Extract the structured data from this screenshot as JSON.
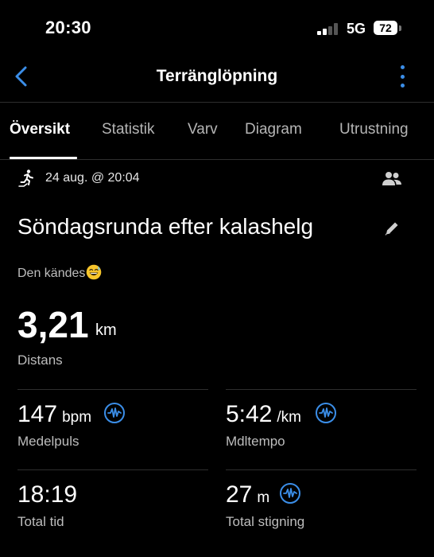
{
  "status_bar": {
    "time": "20:30",
    "network": "5G",
    "battery": "72"
  },
  "header": {
    "title": "Terränglöpning"
  },
  "tabs": [
    {
      "label": "Översikt",
      "active": true
    },
    {
      "label": "Statistik"
    },
    {
      "label": "Varv"
    },
    {
      "label": "Diagram"
    },
    {
      "label": "Utrustning"
    }
  ],
  "activity": {
    "date": "24 aug. @ 20:04",
    "name": "Söndagsrunda efter kalashelg",
    "description": "Den kändes"
  },
  "metrics": {
    "distance": {
      "value": "3,21",
      "unit": "km",
      "label": "Distans"
    },
    "avg_hr": {
      "value": "147",
      "unit": "bpm",
      "label": "Medelpuls"
    },
    "avg_pace": {
      "value": "5:42",
      "unit": "/km",
      "label": "Mdltempo"
    },
    "total_time": {
      "value": "18:19",
      "label": "Total tid"
    },
    "total_ascent": {
      "value": "27",
      "unit": "m",
      "label": "Total stigning"
    }
  },
  "colors": {
    "accent": "#3b8ee8",
    "background": "#000000",
    "divider": "#2e2e2e",
    "secondary_text": "#bdbdbd"
  }
}
